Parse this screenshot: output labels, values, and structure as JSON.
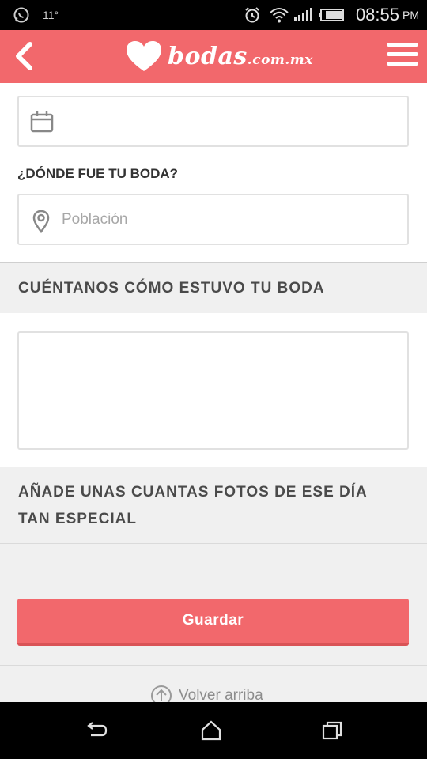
{
  "status_bar": {
    "temperature": "11°",
    "time": "08:55",
    "ampm": "PM",
    "icons": [
      "whatsapp-icon",
      "alarm-icon",
      "wifi-icon",
      "signal-icon",
      "battery-icon"
    ]
  },
  "header": {
    "logo_main": "bodas",
    "logo_suffix": ".com.mx",
    "back_icon": "chevron-left-icon",
    "menu_icon": "hamburger-menu-icon",
    "background_color": "#f2686c"
  },
  "form": {
    "date_icon": "calendar-icon",
    "where_label": "¿DÓNDE FUE TU BODA?",
    "town_placeholder": "Población",
    "town_icon": "location-pin-icon",
    "story_section_title": "CUÉNTANOS CÓMO ESTUVO TU BODA",
    "photos_section_title_line1": "AÑADE UNAS CUANTAS FOTOS DE ESE DÍA",
    "photos_section_title_line2": "TAN ESPECIAL",
    "save_label": "Guardar"
  },
  "footer": {
    "back_to_top_label": "Volver arriba"
  },
  "nav_bar": {
    "icons": [
      "back-nav-icon",
      "home-nav-icon",
      "recents-nav-icon"
    ]
  },
  "colors": {
    "accent": "#f2686c",
    "section_bg": "#f0f0f0"
  }
}
